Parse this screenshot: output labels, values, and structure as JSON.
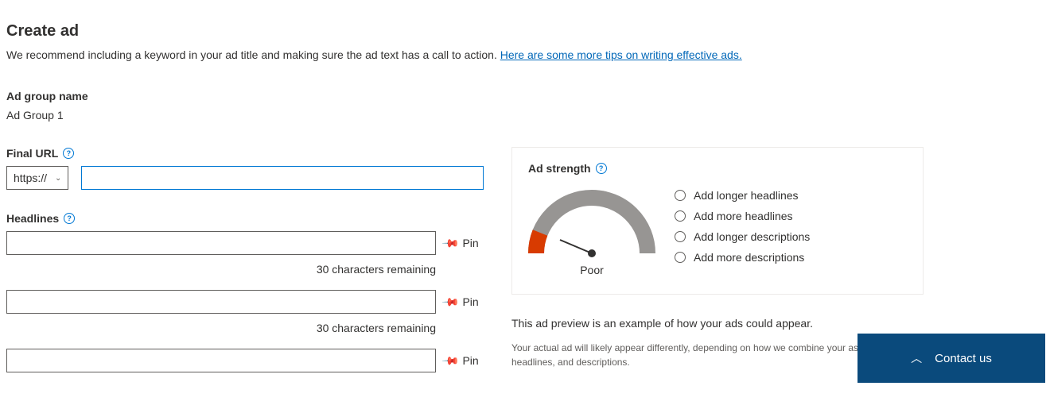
{
  "page": {
    "title": "Create ad",
    "subtitle_prefix": "We recommend including a keyword in your ad title and making sure the ad text has a call to action. ",
    "subtitle_link": "Here are some more tips on writing effective ads."
  },
  "ad_group": {
    "label": "Ad group name",
    "value": "Ad Group 1"
  },
  "final_url": {
    "label": "Final URL",
    "protocol": "https://",
    "value": ""
  },
  "headlines": {
    "label": "Headlines",
    "items": [
      {
        "value": "",
        "counter": "30 characters remaining",
        "pin_label": "Pin"
      },
      {
        "value": "",
        "counter": "30 characters remaining",
        "pin_label": "Pin"
      },
      {
        "value": "",
        "counter": "",
        "pin_label": "Pin"
      }
    ]
  },
  "ad_strength": {
    "title": "Ad strength",
    "rating": "Poor",
    "suggestions": [
      "Add longer headlines",
      "Add more headlines",
      "Add longer descriptions",
      "Add more descriptions"
    ]
  },
  "preview": {
    "text": "This ad preview is an example of how your ads could appear.",
    "note": "Your actual ad will likely appear differently, depending on how we combine your assets, headlines, and descriptions."
  },
  "contact": {
    "label": "Contact us"
  }
}
